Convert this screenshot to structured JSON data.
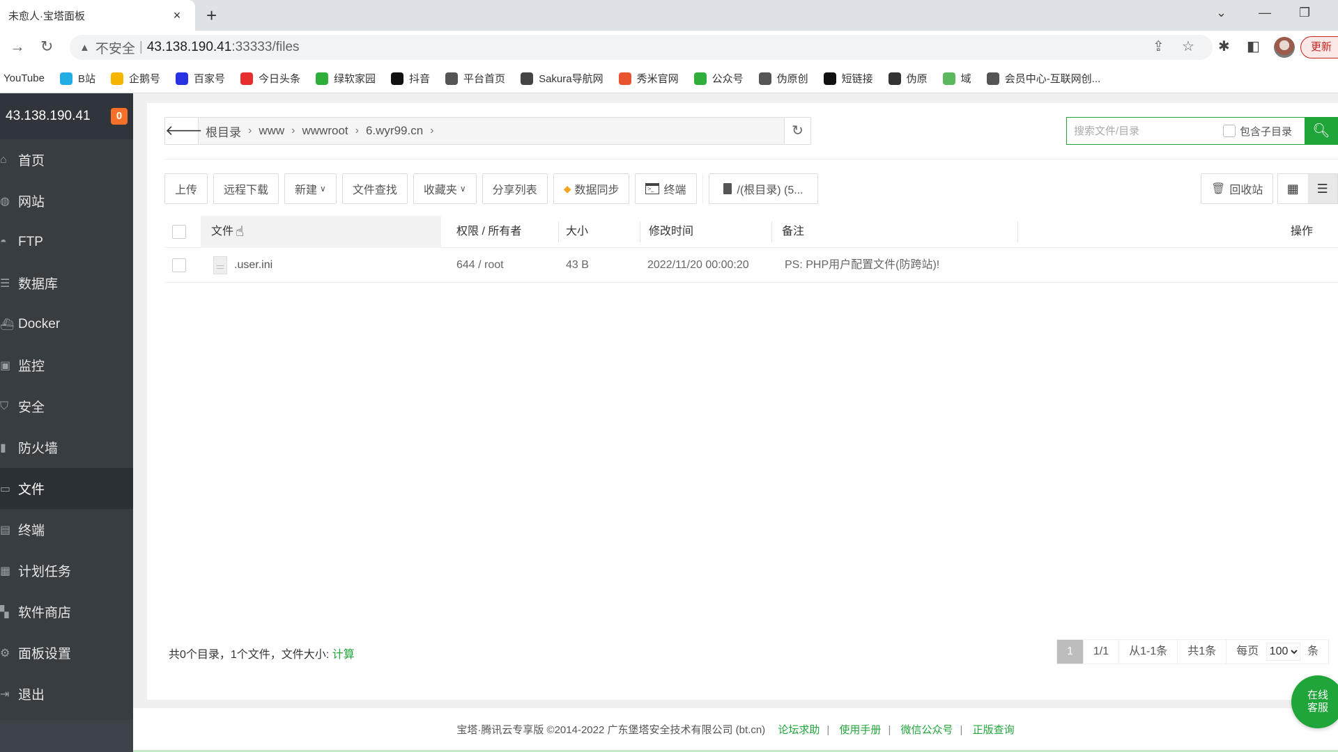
{
  "browser": {
    "tab_title": "未愈人·宝塔面板",
    "tab_close_icon": "×",
    "new_tab_icon": "+",
    "window_controls": [
      "⌄",
      "—",
      "❐"
    ],
    "address": {
      "warning_icon": "▲",
      "insecure_label": "不安全",
      "separator": "|",
      "host": "43.138.190.41",
      "path": ":33333/files"
    },
    "update_button": "更新",
    "bookmarks": [
      {
        "label": "YouTube",
        "icon": "none",
        "color": ""
      },
      {
        "label": "B站",
        "icon": "bilibili-icon",
        "color": "#23ade5"
      },
      {
        "label": "企鹅号",
        "icon": "penguin-icon",
        "color": "#f5b400"
      },
      {
        "label": "百家号",
        "icon": "baidu-paw-icon",
        "color": "#2932e1"
      },
      {
        "label": "今日头条",
        "icon": "toutiao-icon",
        "color": "#e62e2e"
      },
      {
        "label": "绿软家园",
        "icon": "green-g-icon",
        "color": "#2fae3c"
      },
      {
        "label": "抖音",
        "icon": "douyin-icon",
        "color": "#111111"
      },
      {
        "label": "平台首页",
        "icon": "globe-icon",
        "color": "#555555"
      },
      {
        "label": "Sakura导航网",
        "icon": "robot-icon",
        "color": "#444444"
      },
      {
        "label": "秀米官网",
        "icon": "xiumi-icon",
        "color": "#e8542e"
      },
      {
        "label": "公众号",
        "icon": "wechat-mp-icon",
        "color": "#2fae3c"
      },
      {
        "label": "伪原创",
        "icon": "globe-icon",
        "color": "#555555"
      },
      {
        "label": "短链接",
        "icon": "swan-icon",
        "color": "#111111"
      },
      {
        "label": "伪原",
        "icon": "cloud-icon",
        "color": "#333333"
      },
      {
        "label": "域",
        "icon": "n-icon",
        "color": "#5cb85c"
      },
      {
        "label": "会员中心-互联网创...",
        "icon": "globe-icon",
        "color": "#555555"
      }
    ]
  },
  "sidebar": {
    "server_ip": "43.138.190.41",
    "badge_count": "0",
    "items": [
      {
        "label": "首页",
        "icon": "⌂",
        "name": "home"
      },
      {
        "label": "网站",
        "icon": "◍",
        "name": "website"
      },
      {
        "label": "FTP",
        "icon": "◓",
        "name": "ftp"
      },
      {
        "label": "数据库",
        "icon": "☰",
        "name": "database"
      },
      {
        "label": "Docker",
        "icon": "⛴",
        "name": "docker"
      },
      {
        "label": "监控",
        "icon": "▣",
        "name": "monitor"
      },
      {
        "label": "安全",
        "icon": "⛉",
        "name": "security"
      },
      {
        "label": "防火墙",
        "icon": "▮",
        "name": "firewall"
      },
      {
        "label": "文件",
        "icon": "▭",
        "name": "files",
        "active": true
      },
      {
        "label": "终端",
        "icon": "▤",
        "name": "terminal"
      },
      {
        "label": "计划任务",
        "icon": "▦",
        "name": "cron"
      },
      {
        "label": "软件商店",
        "icon": "▚",
        "name": "app-store"
      },
      {
        "label": "面板设置",
        "icon": "⚙",
        "name": "panel-settings"
      },
      {
        "label": "退出",
        "icon": "⇥",
        "name": "logout"
      }
    ]
  },
  "files": {
    "breadcrumb": [
      "根目录",
      "www",
      "wwwroot",
      "6.wyr99.cn"
    ],
    "search_placeholder": "搜索文件/目录",
    "include_subdir_label": "包含子目录",
    "toolbar": {
      "upload": "上传",
      "remote_download": "远程下载",
      "new": "新建",
      "file_search": "文件查找",
      "favorites": "收藏夹",
      "share_list": "分享列表",
      "data_sync": "数据同步",
      "terminal": "终端",
      "disk": "/(根目录) (5..."
    },
    "recycle_bin": "回收站",
    "columns": {
      "file": "文件",
      "perm_owner": "权限 / 所有者",
      "size": "大小",
      "modified": "修改时间",
      "remark": "备注",
      "actions": "操作"
    },
    "rows": [
      {
        "name": ".user.ini",
        "perm_owner": "644 / root",
        "size": "43 B",
        "modified": "2022/11/20 00:00:20",
        "remark": "PS: PHP用户配置文件(防跨站)!"
      }
    ],
    "summary_text": "共0个目录，1个文件，文件大小:",
    "summary_calc": "计算",
    "pager": {
      "current_page": "1",
      "page_of": "1/1",
      "range": "从1-1条",
      "total": "共1条",
      "per_page_label": "每页",
      "per_page_value": "100",
      "per_page_unit": "条"
    }
  },
  "online_service": {
    "line1": "在线",
    "line2": "客服"
  },
  "footer": {
    "copyright": "宝塔·腾讯云专享版 ©2014-2022 广东堡塔安全技术有限公司 (bt.cn)",
    "links": [
      "论坛求助",
      "使用手册",
      "微信公众号",
      "正版查询"
    ]
  }
}
